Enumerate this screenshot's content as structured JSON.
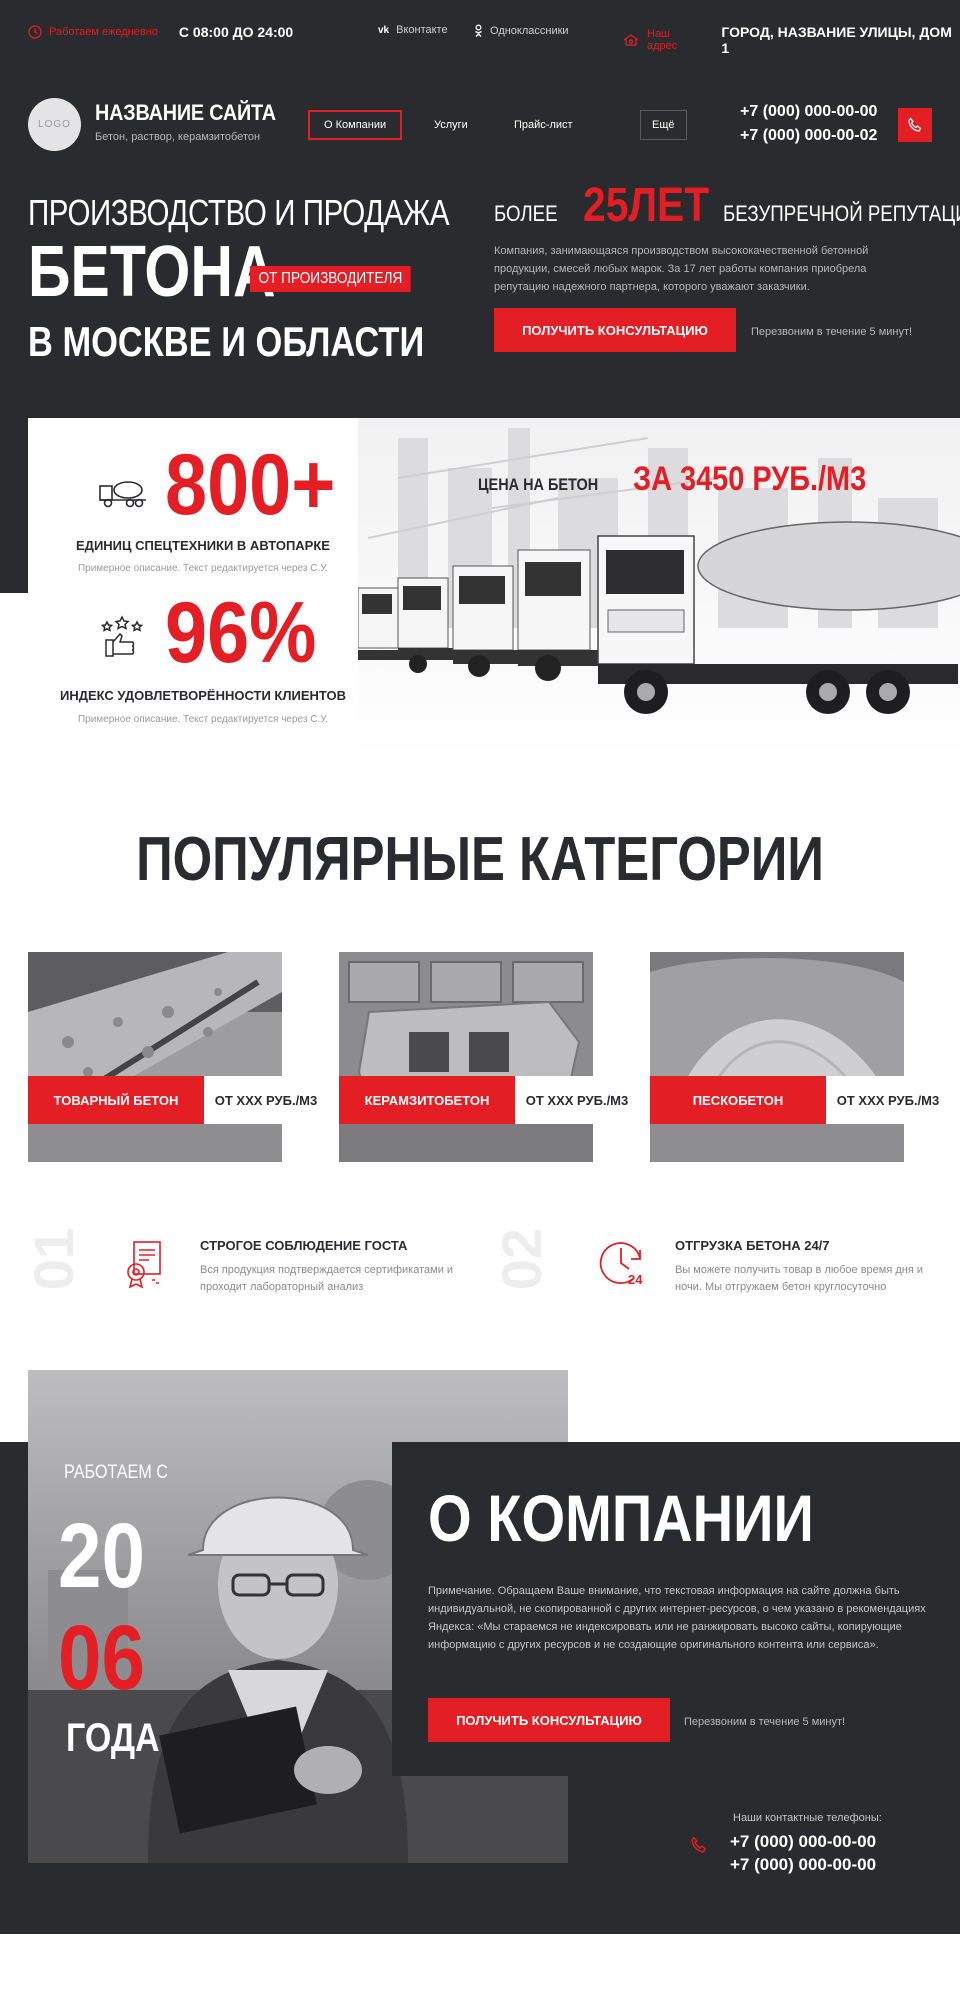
{
  "topbar": {
    "work_label": "Работаем ежедневно",
    "work_hours": "С 08:00 ДО 24:00",
    "vk": "Вконтакте",
    "ok": "Одноклассники",
    "address_label": "Наш адрес",
    "address": "ГОРОД, НАЗВАНИЕ УЛИЦЫ, ДОМ 1"
  },
  "header": {
    "logo": "LOGO",
    "site_name": "НАЗВАНИЕ САЙТА",
    "site_desc": "Бетон, раствор, керамзитобетон",
    "nav": [
      "О Компании",
      "Услуги",
      "Прайс-лист",
      "Ещё"
    ],
    "phone_1": "+7 (000) 000-00-00",
    "phone_2": "+7 (000) 000-00-02"
  },
  "hero": {
    "line1": "ПРОИЗВОДСТВО И ПРОДАЖА",
    "line2": "БЕТОНА",
    "badge": "ОТ ПРОИЗВОДИТЕЛЯ",
    "line3": "В МОСКВЕ И ОБЛАСТИ",
    "exp_pre": "БОЛЕЕ",
    "exp_big": "25ЛЕТ",
    "exp_post": "БЕЗУПРЕЧНОЙ РЕПУТАЦИИ",
    "exp_desc": "Компания, занимающаяся производством высококачественной бетонной продукции, смесей любых марок. За 17 лет работы компания приобрела репутацию надежного партнера, которого уважают заказчики.",
    "cta": "ПОЛУЧИТЬ КОНСУЛЬТАЦИЮ",
    "cta_note": "Перезвоним в течение 5 минут!"
  },
  "stats": {
    "items": [
      {
        "value": "800+",
        "label": "ЕДИНИЦ СПЕЦТЕХНИКИ В АВТОПАРКЕ",
        "desc": "Примерное описание. Текст редактируется через С.У."
      },
      {
        "value": "96%",
        "label": "ИНДЕКС УДОВЛЕТВОРЁННОСТИ КЛИЕНТОВ",
        "desc": "Примерное описание. Текст редактируется через С.У."
      }
    ],
    "price_label": "ЦЕНА НА БЕТОН",
    "price_value": "ЗА 3450 РУБ./М3"
  },
  "categories": {
    "title": "ПОПУЛЯРНЫЕ КАТЕГОРИИ",
    "items": [
      {
        "name": "ТОВАРНЫЙ БЕТОН",
        "price": "ОТ XXX РУБ./М3"
      },
      {
        "name": "КЕРАМЗИТОБЕТОН",
        "price": "ОТ XXX РУБ./М3"
      },
      {
        "name": "ПЕСКОБЕТОН",
        "price": "ОТ XXX РУБ./М3"
      }
    ]
  },
  "features": [
    {
      "num": "01",
      "title": "СТРОГОЕ СОБЛЮДЕНИЕ ГОСТА",
      "desc": "Вся продукция подтверждается сертификатами и проходит лабораторный анализ"
    },
    {
      "num": "02",
      "title": "ОТГРУЗКА БЕТОНА 24/7",
      "desc": "Вы можете получить товар в любое время дня и ночи. Мы отгружаем бетон круглосуточно"
    }
  ],
  "about": {
    "since_label": "РАБОТАЕМ С",
    "since_top": "20",
    "since_bottom": "06",
    "since_suffix": "ГОДА",
    "title": "О КОМПАНИИ",
    "text": "Примечание. Обращаем Ваше внимание, что текстовая информация на сайте должна быть индивидуальной, не скопированной с других интернет-ресурсов, о чем указано в рекомендациях Яндекса: «Мы стараемся не индексировать или не ранжировать высоко сайты, копирующие информацию с других ресурсов и не создающие оригинального контента или сервиса».",
    "cta": "ПОЛУЧИТЬ КОНСУЛЬТАЦИЮ",
    "cta_note": "Перезвоним в течение 5 минут!",
    "contacts_label": "Наши контактные телефоны:",
    "phone_1": "+7 (000) 000-00-00",
    "phone_2": "+7 (000) 000-00-00"
  },
  "colors": {
    "accent": "#e31e24",
    "dark": "#2a2b2e",
    "light_text": "#b8b8bc"
  },
  "icons": [
    "clock-icon",
    "vk-icon",
    "ok-icon",
    "location-icon",
    "phone-icon",
    "concrete-mixer-icon",
    "rating-thumb-icon",
    "certificate-icon",
    "clock-24-icon"
  ]
}
